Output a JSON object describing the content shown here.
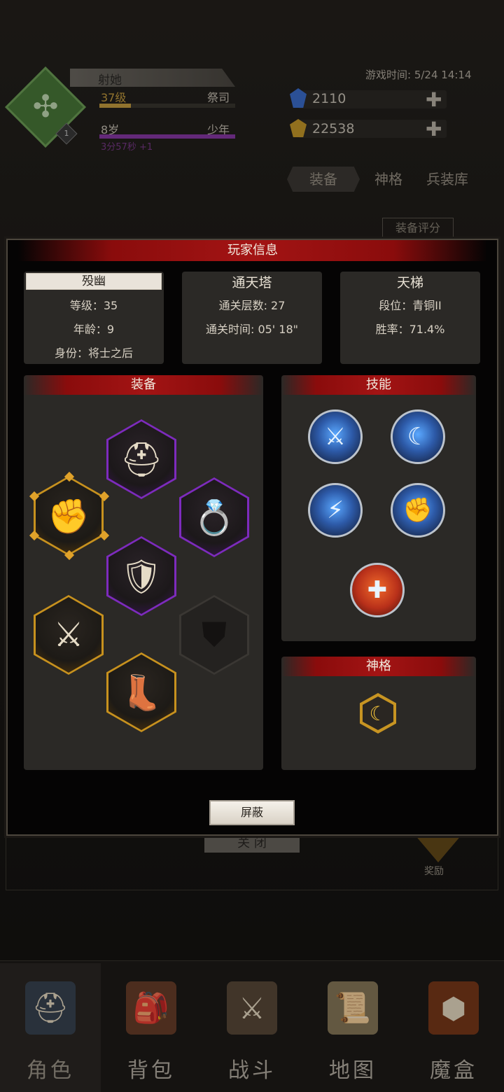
{
  "background": {
    "top_title": "",
    "player": {
      "name": "射她",
      "level": "37级",
      "role": "祭司",
      "level_progress": 0.23,
      "age": "8岁",
      "life_stage": "少年",
      "timer": "3分57秒 +1",
      "badge_number": "1"
    },
    "game_time": "游戏时间: 5/24 14:14",
    "resources": {
      "gems": "2110",
      "gold": "22538",
      "add_symbol": "✚"
    },
    "tabs": [
      "装备",
      "神格",
      "兵装库"
    ],
    "score_button": "装备评分",
    "close_button": "关 闭",
    "reward_label": "奖励"
  },
  "bottom_nav": [
    {
      "label": "角色",
      "icon": "helmet-icon",
      "glyph": "⛑"
    },
    {
      "label": "背包",
      "icon": "backpack-icon",
      "glyph": "🎒"
    },
    {
      "label": "战斗",
      "icon": "sword-shield-icon",
      "glyph": "⚔"
    },
    {
      "label": "地图",
      "icon": "map-scroll-icon",
      "glyph": "📜"
    },
    {
      "label": "魔盒",
      "icon": "magic-box-icon",
      "glyph": "⬢"
    }
  ],
  "modal": {
    "title": "玩家信息",
    "profile": {
      "name": "殁幽",
      "level": "等级：35",
      "age": "年龄：9",
      "identity": "身份：将士之后"
    },
    "tower": {
      "title": "通天塔",
      "floors": "通关层数: 27",
      "time": "通关时间: 05' 18\""
    },
    "ladder": {
      "title": "天梯",
      "rank": "段位：青铜II",
      "winrate": "胜率：71.4%"
    },
    "equipment": {
      "title": "装备",
      "slots": [
        {
          "slot": "helmet",
          "rarity": "purple",
          "glyph": "⛑"
        },
        {
          "slot": "gauntlet",
          "rarity": "gold",
          "glyph": "✊"
        },
        {
          "slot": "ring",
          "rarity": "purple",
          "glyph": "💍"
        },
        {
          "slot": "armor",
          "rarity": "purple",
          "glyph": "🛡"
        },
        {
          "slot": "weapon",
          "rarity": "gold",
          "glyph": "⚔"
        },
        {
          "slot": "shield",
          "rarity": "empty",
          "glyph": "⛊"
        },
        {
          "slot": "boots",
          "rarity": "gold",
          "glyph": "👢"
        }
      ]
    },
    "skills": {
      "title": "技能",
      "items": [
        {
          "icon": "multi-sword-strike-icon",
          "glyph": "⚔"
        },
        {
          "icon": "blade-arc-icon",
          "glyph": "☾"
        },
        {
          "icon": "sword-slash-icon",
          "glyph": "⚡"
        },
        {
          "icon": "fist-strike-icon",
          "glyph": "✊"
        },
        {
          "icon": "holy-cross-icon",
          "glyph": "✚"
        }
      ]
    },
    "divinity": {
      "title": "神格",
      "glyph": "☾"
    },
    "block_button": "屏蔽"
  }
}
